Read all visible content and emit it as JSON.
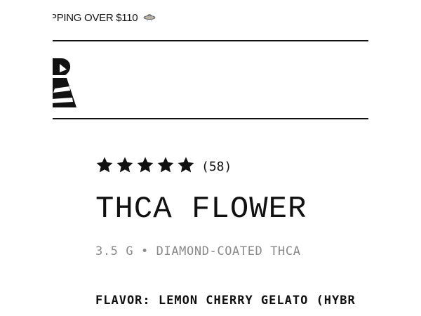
{
  "announcement": {
    "text": "PPING OVER $110",
    "icon": "ufo-icon"
  },
  "brand": {
    "logo_icon": "brand-logo-icon"
  },
  "product": {
    "rating": {
      "stars": 5,
      "max_stars": 5,
      "count_label": "(58)"
    },
    "title": "THCA FLOWER",
    "subtitle": "3.5 G • DIAMOND-COATED THCA",
    "flavor": "FLAVOR: LEMON CHERRY GELATO (HYBR"
  },
  "colors": {
    "text": "#111111",
    "muted": "#8a8a8a",
    "background": "#ffffff"
  }
}
